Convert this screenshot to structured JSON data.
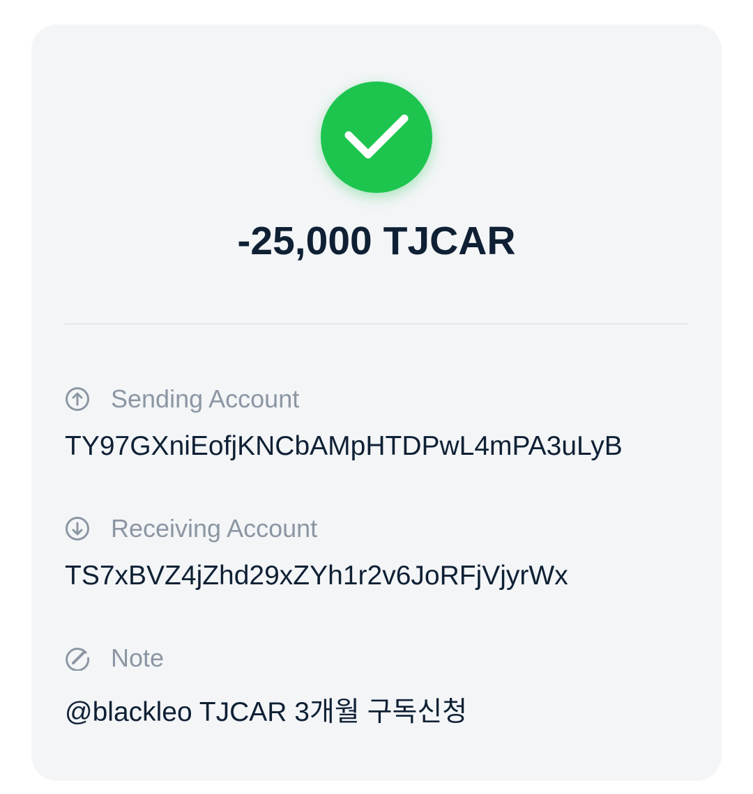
{
  "transaction": {
    "status_icon": "check-circle-icon",
    "status_color": "#1dc54f",
    "amount": "-25,000 TJCAR"
  },
  "fields": {
    "sending": {
      "icon": "arrow-up-circle-icon",
      "label": "Sending Account",
      "value": "TY97GXniEofjKNCbAMpHTDPwL4mPA3uLyB"
    },
    "receiving": {
      "icon": "arrow-down-circle-icon",
      "label": "Receiving Account",
      "value": "TS7xBVZ4jZhd29xZYh1r2v6JoRFjVjyrWx"
    },
    "note": {
      "icon": "pencil-circle-icon",
      "label": "Note",
      "value": "@blackleo TJCAR 3개월 구독신청"
    }
  },
  "colors": {
    "card_background": "#f3f5f7",
    "text_primary": "#0f2034",
    "text_secondary": "#8c96a3"
  }
}
